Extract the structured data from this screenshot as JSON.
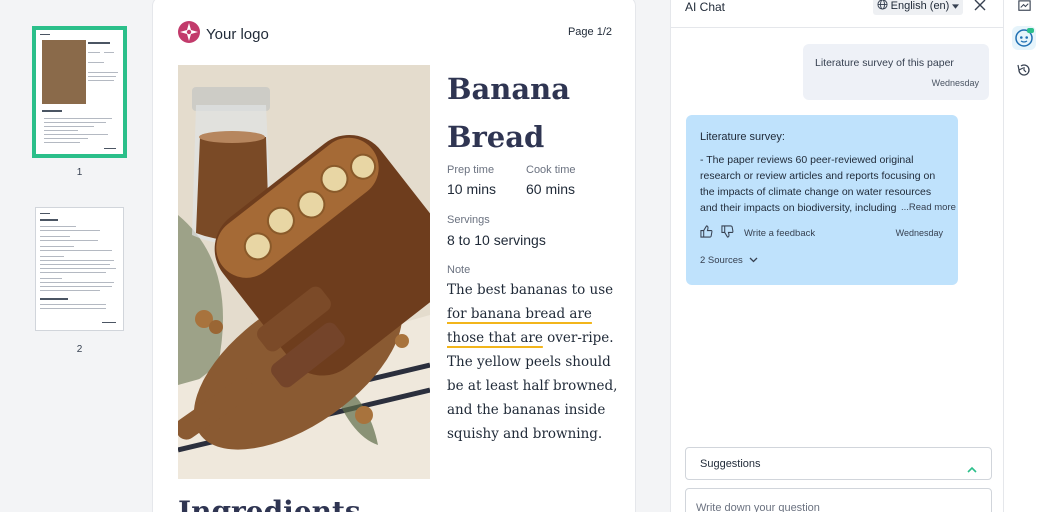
{
  "thumbnails": [
    {
      "label": "1",
      "selected": true
    },
    {
      "label": "2",
      "selected": false
    }
  ],
  "document": {
    "logo_text": "Your logo",
    "page_indicator": "Page 1/2",
    "title": "Banana Bread",
    "prep_time_label": "Prep time",
    "prep_time_value": "10 mins",
    "cook_time_label": "Cook time",
    "cook_time_value": "60 mins",
    "servings_label": "Servings",
    "servings_value": "8 to 10 servings",
    "note_label": "Note",
    "note_text_before": "The best bananas to use ",
    "note_text_highlight": "for banana bread are those that are",
    "note_text_after": " over-ripe. The yellow peels should be at least half browned, and the bananas inside squishy and browning.",
    "next_section_peek": "Ingredients"
  },
  "chat": {
    "title": "AI Chat",
    "language": "English (en)",
    "user_message": "Literature survey of this paper",
    "user_message_time": "Wednesday",
    "ai_heading": "Literature survey:",
    "ai_body": "- The paper reviews 60 peer-reviewed original research or review articles and reports focusing on the impacts of climate change on water resources and their impacts on biodiversity, including",
    "read_more": "...Read more",
    "feedback_label": "Write a feedback",
    "ai_message_time": "Wednesday",
    "sources_label": "2 Sources",
    "suggestions_label": "Suggestions",
    "question_placeholder": "Write down your question"
  },
  "colors": {
    "accent_green": "#2bbf8a",
    "ai_bubble": "#bfe2fc",
    "user_bubble": "#eef1f7",
    "title_navy": "#2f3552",
    "highlight_underline": "#f2b51b",
    "logo_pink": "#c23a6b"
  },
  "icons": [
    "logo-mark-icon",
    "globe-icon",
    "caret-down-icon",
    "close-icon",
    "thumbs-up-icon",
    "thumbs-down-icon",
    "chevron-down-icon",
    "chevron-up-icon",
    "presentation-icon",
    "ai-assistant-icon",
    "history-icon"
  ]
}
